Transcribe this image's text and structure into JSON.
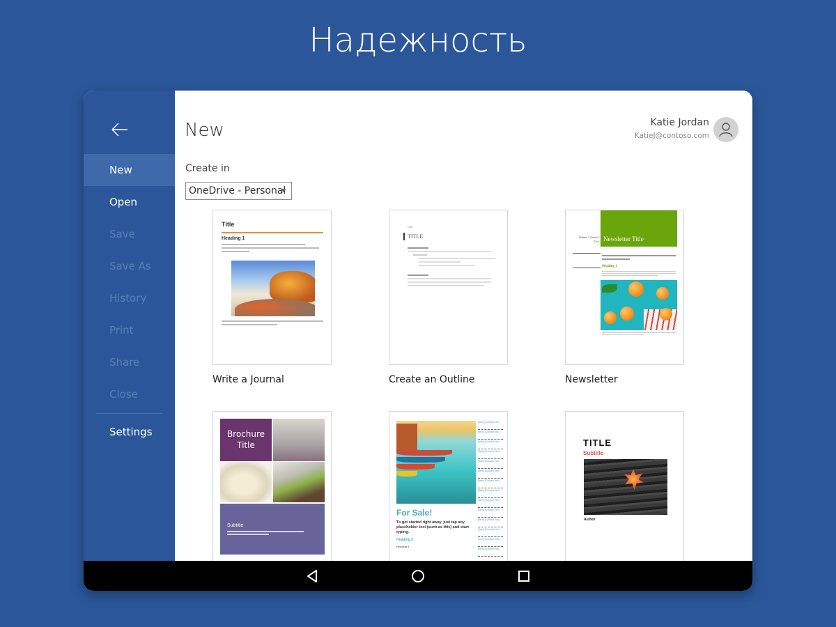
{
  "promo": {
    "title": "Надежность"
  },
  "sidebar": {
    "items": [
      {
        "label": "New",
        "state": "active"
      },
      {
        "label": "Open",
        "state": "enabled"
      },
      {
        "label": "Save",
        "state": "disabled"
      },
      {
        "label": "Save As",
        "state": "disabled"
      },
      {
        "label": "History",
        "state": "disabled"
      },
      {
        "label": "Print",
        "state": "disabled"
      },
      {
        "label": "Share",
        "state": "disabled"
      },
      {
        "label": "Close",
        "state": "disabled"
      }
    ],
    "settings_label": "Settings",
    "back_icon": "arrow-left-icon"
  },
  "header": {
    "title": "New",
    "user": {
      "name": "Katie Jordan",
      "email": "KatieJ@contoso.com",
      "avatar_icon": "person-icon"
    }
  },
  "create_in": {
    "label": "Create in",
    "selected": "OneDrive - Personal"
  },
  "templates": [
    {
      "caption": "Write a Journal",
      "preview": {
        "title": "Title",
        "heading": "Heading 1"
      }
    },
    {
      "caption": "Create an Outline",
      "preview": {
        "date": "Date",
        "title": "TITLE"
      }
    },
    {
      "caption": "Newsletter",
      "preview": {
        "title": "Newsletter Title",
        "volume": "Volume 1 | Issue 1",
        "date": "Date",
        "heading": "Heading 1"
      }
    },
    {
      "caption": "",
      "preview": {
        "title": "Brochure Title",
        "subtitle": "Subtitle"
      }
    },
    {
      "caption": "",
      "preview": {
        "title": "For Sale!",
        "body": "To get started right away, just tap any placeholder text (such as this) and start typing.",
        "heading3": "Heading 3",
        "heading4": "Heading 4",
        "tab_label": "[Item] [Contact Info]"
      }
    },
    {
      "caption": "",
      "preview": {
        "title": "TITLE",
        "subtitle": "Subtitle",
        "author": "Author"
      }
    }
  ],
  "system_nav": {
    "back": "back-icon",
    "home": "home-icon",
    "recents": "recents-icon"
  },
  "colors": {
    "brand": "#2b579a",
    "active_nav": "#3e6aab",
    "disabled_nav": "#5a7fb7"
  }
}
